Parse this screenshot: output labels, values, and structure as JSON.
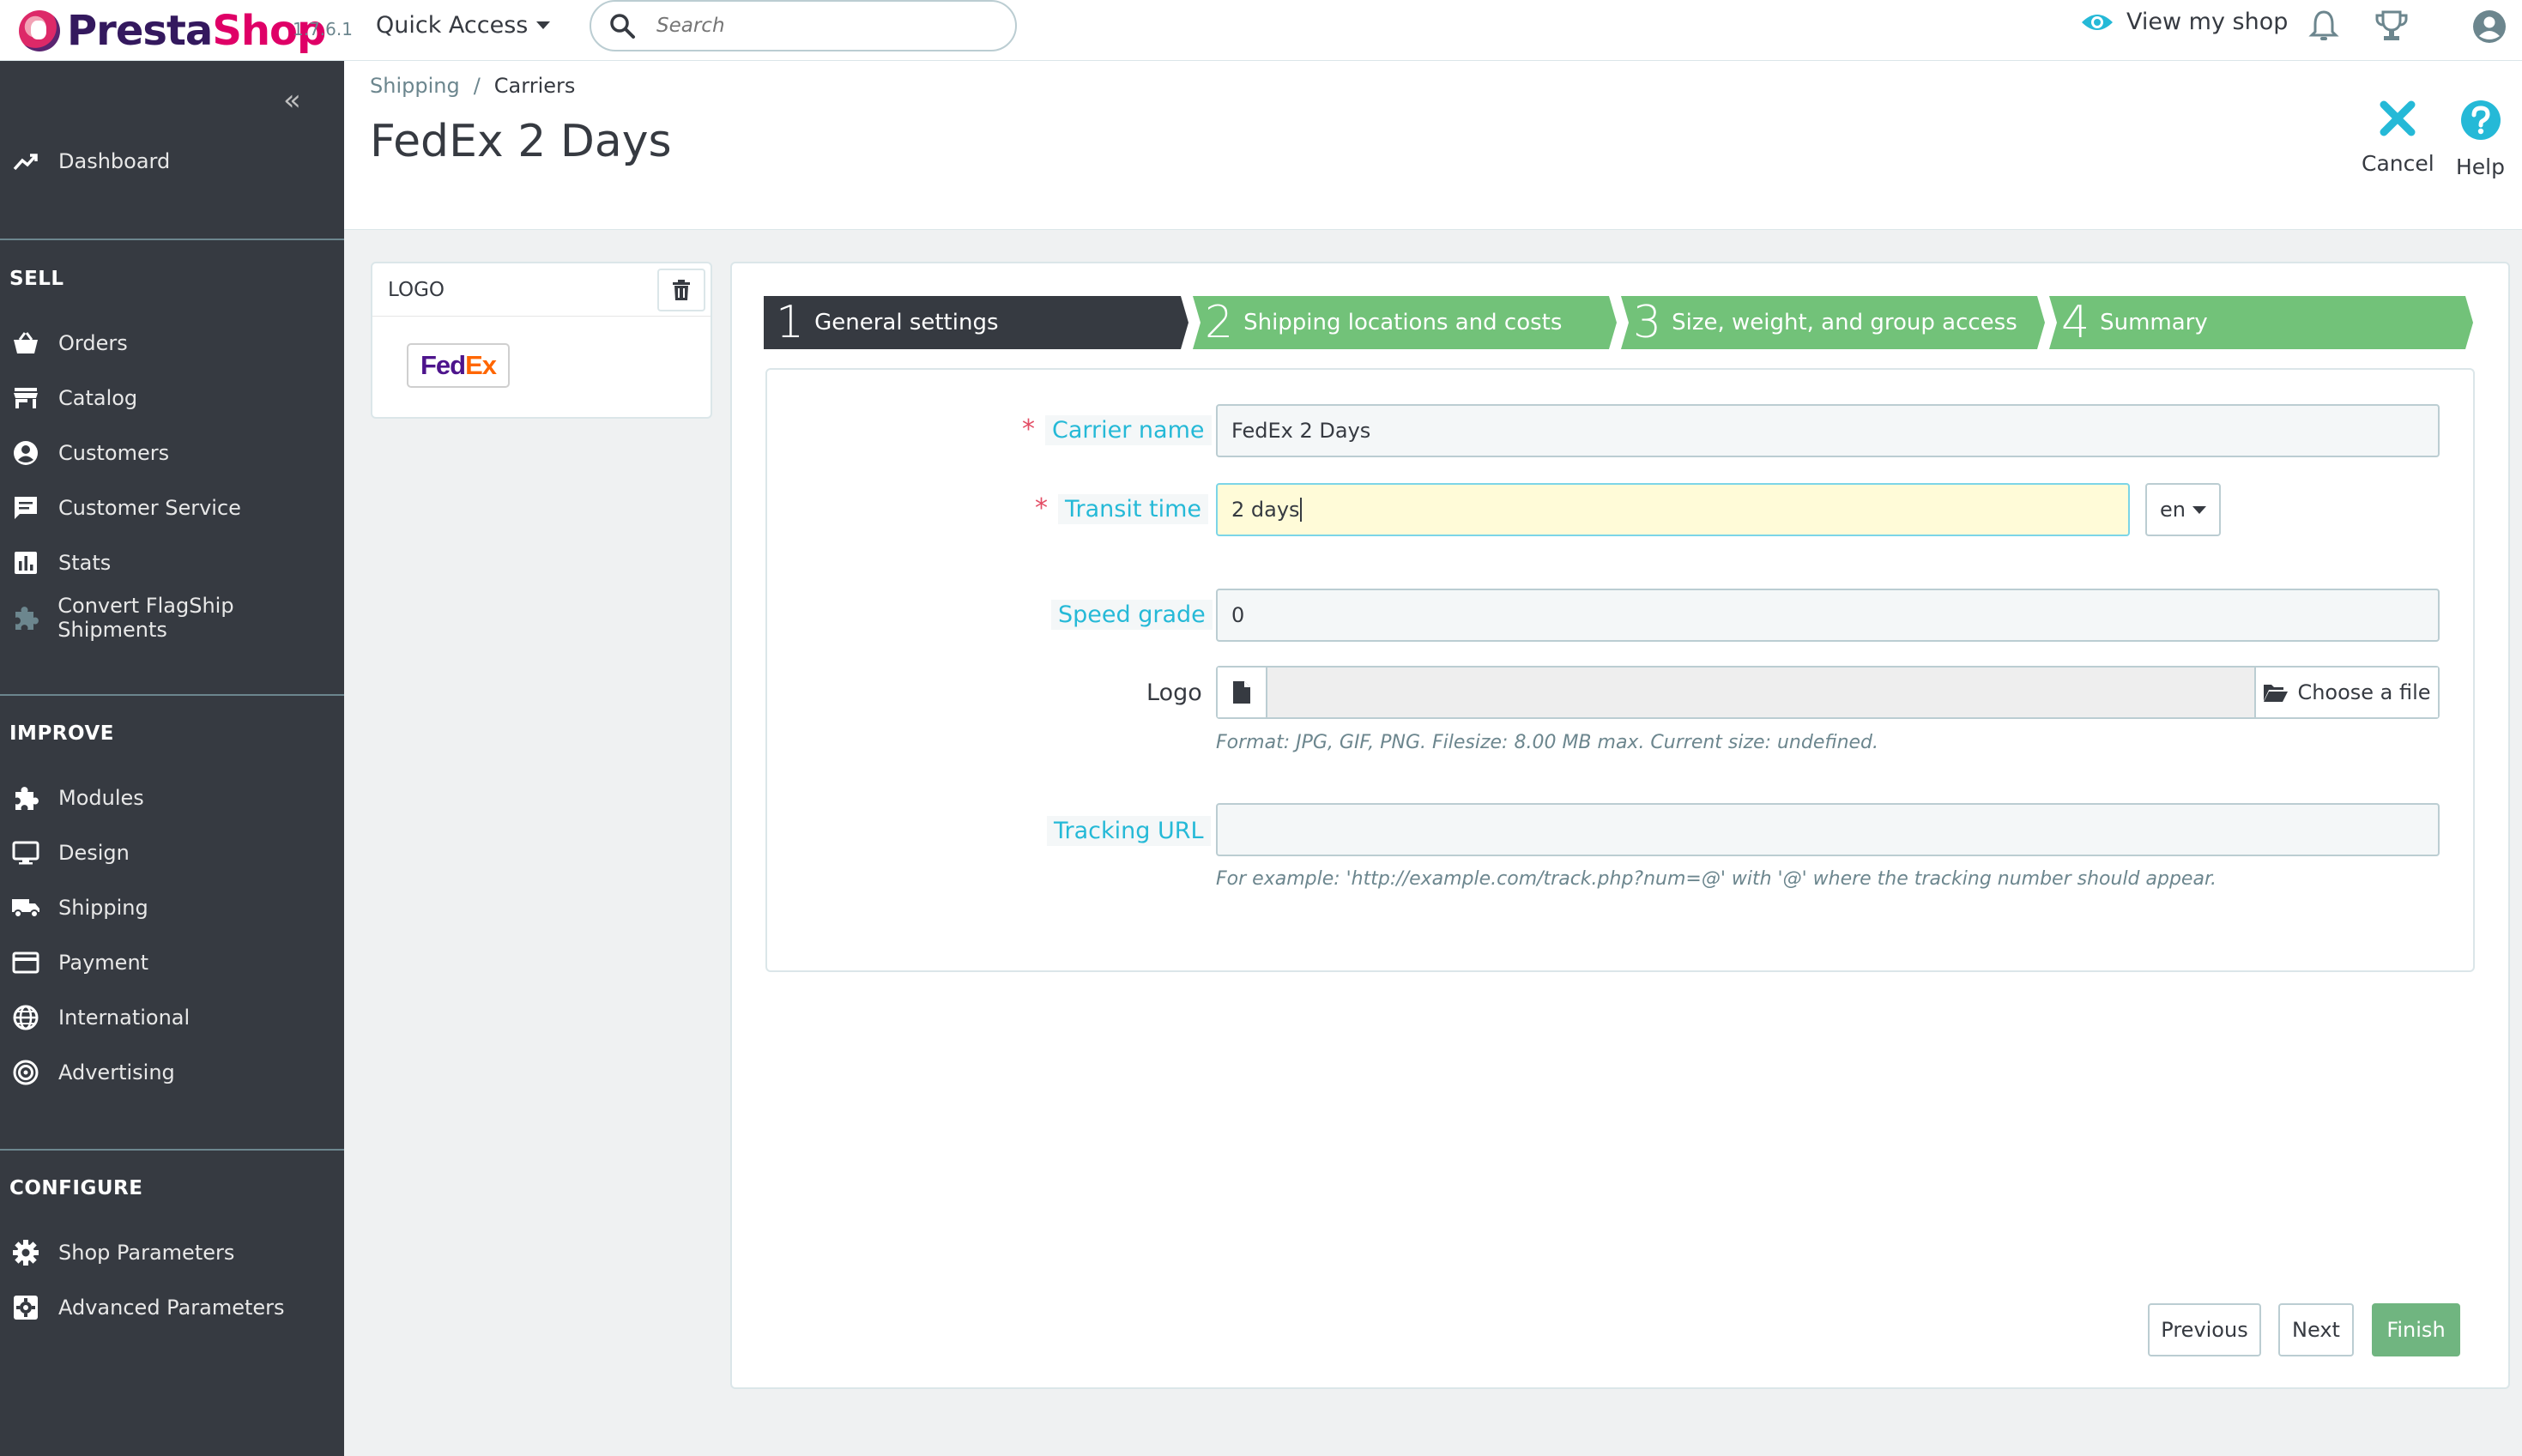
{
  "header": {
    "brand_presta": "Presta",
    "brand_shop": "Shop",
    "version": "1.7.6.1",
    "quick_access": "Quick Access",
    "search_placeholder": "Search",
    "view_shop": "View my shop"
  },
  "sidebar": {
    "collapse": "«",
    "dashboard": "Dashboard",
    "sections": {
      "sell": "SELL",
      "improve": "IMPROVE",
      "configure": "CONFIGURE"
    },
    "sell_items": [
      {
        "label": "Orders",
        "icon": "basket-icon"
      },
      {
        "label": "Catalog",
        "icon": "store-icon"
      },
      {
        "label": "Customers",
        "icon": "account-icon"
      },
      {
        "label": "Customer Service",
        "icon": "chat-icon"
      },
      {
        "label": "Stats",
        "icon": "chart-icon"
      },
      {
        "label": "Convert FlagShip Shipments",
        "icon": "puzzle-icon"
      }
    ],
    "improve_items": [
      {
        "label": "Modules",
        "icon": "puzzle-icon"
      },
      {
        "label": "Design",
        "icon": "monitor-icon"
      },
      {
        "label": "Shipping",
        "icon": "truck-icon"
      },
      {
        "label": "Payment",
        "icon": "card-icon"
      },
      {
        "label": "International",
        "icon": "globe-icon"
      },
      {
        "label": "Advertising",
        "icon": "target-icon"
      }
    ],
    "configure_items": [
      {
        "label": "Shop Parameters",
        "icon": "gear-icon"
      },
      {
        "label": "Advanced Parameters",
        "icon": "settings-box-icon"
      }
    ]
  },
  "breadcrumb": {
    "parent": "Shipping",
    "separator": "/",
    "current": "Carriers"
  },
  "page_title": "FedEx 2 Days",
  "toolbar": {
    "cancel": "Cancel",
    "help": "Help"
  },
  "logo_panel": {
    "title": "LOGO",
    "fedex_fed": "Fed",
    "fedex_ex": "Ex"
  },
  "steps": [
    {
      "num": "1",
      "label": "General settings"
    },
    {
      "num": "2",
      "label": "Shipping locations and costs"
    },
    {
      "num": "3",
      "label": "Size, weight, and group access"
    },
    {
      "num": "4",
      "label": "Summary"
    }
  ],
  "form": {
    "required_mark": "*",
    "carrier_name_label": "Carrier name",
    "carrier_name_value": "FedEx 2 Days",
    "transit_time_label": "Transit time",
    "transit_time_value": "2 days",
    "lang": "en",
    "speed_grade_label": "Speed grade",
    "speed_grade_value": "0",
    "logo_label": "Logo",
    "choose_file": "Choose a file",
    "logo_help": "Format: JPG, GIF, PNG. Filesize: 8.00 MB max. Current size: undefined.",
    "tracking_url_label": "Tracking URL",
    "tracking_url_value": "",
    "tracking_help": "For example: 'http://example.com/track.php?num=@' with '@' where the tracking number should appear."
  },
  "buttons": {
    "previous": "Previous",
    "next": "Next",
    "finish": "Finish"
  },
  "colors": {
    "sidebar_bg": "#363a41",
    "step_active": "#363a41",
    "step_inactive": "#72c279",
    "accent": "#25b9d7",
    "finish": "#70b580"
  }
}
